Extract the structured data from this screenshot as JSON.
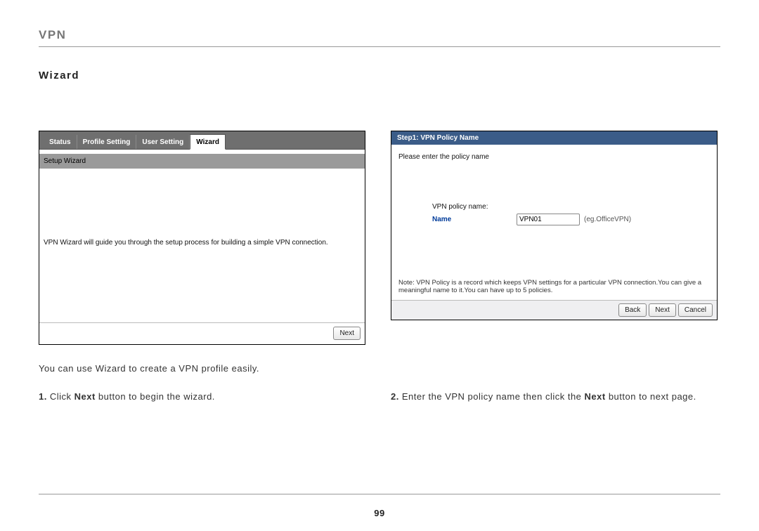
{
  "header": {
    "title": "VPN",
    "subtitle": "Wizard"
  },
  "left_panel": {
    "tabs": [
      "Status",
      "Profile Setting",
      "User Setting",
      "Wizard"
    ],
    "active_tab_index": 3,
    "section_bar": "Setup Wizard",
    "body_text": "VPN Wizard will guide you through the setup process for building a simple VPN connection.",
    "next_btn": "Next"
  },
  "right_panel": {
    "step_title": "Step1: VPN Policy Name",
    "prompt": "Please enter the policy name",
    "field_header": "VPN policy name:",
    "field_label": "Name",
    "field_value": "VPN01",
    "field_hint": "(eg.OfficeVPN)",
    "note": "Note: VPN Policy is a record which keeps VPN settings for a particular VPN connection.You can give a meaningful name to it.You can have up to 5 policies.",
    "buttons": {
      "back": "Back",
      "next": "Next",
      "cancel": "Cancel"
    }
  },
  "caption": "You can use Wizard to create a VPN profile easily.",
  "steps": [
    {
      "num": "1.",
      "pre": "Click ",
      "bold": "Next",
      "post": " button to begin the wizard."
    },
    {
      "num": "2.",
      "pre": "Enter the VPN policy name then click the ",
      "bold": "Next",
      "post": " button to next page."
    }
  ],
  "page_number": "99"
}
